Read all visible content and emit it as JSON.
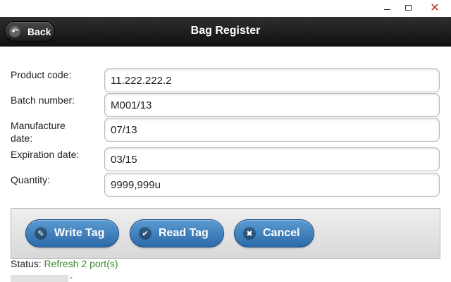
{
  "header": {
    "title": "Bag Register",
    "back_label": "Back"
  },
  "window_controls": {
    "minimize": "minimize",
    "maximize": "maximize",
    "close": "✕"
  },
  "form": {
    "fields": [
      {
        "label": "Product code:",
        "value": "11.222.222.2"
      },
      {
        "label": "Batch number:",
        "value": "M001/13"
      },
      {
        "label": "Manufacture date:",
        "value": "07/13"
      },
      {
        "label": "Expiration date:",
        "value": "03/15"
      },
      {
        "label": "Quantity:",
        "value": "9999,999u"
      }
    ]
  },
  "actions": {
    "write_tag": "Write Tag",
    "read_tag": "Read Tag",
    "cancel": "Cancel"
  },
  "icons": {
    "back": "back-arrow-icon",
    "write": "pencil-icon",
    "read": "checkmark-icon",
    "cancel": "x-icon"
  },
  "status": {
    "label": "Status:",
    "value": "Refresh 2 port(s)"
  },
  "footer": {
    "dash": "-"
  },
  "colors": {
    "header_bg": "#1a1a1a",
    "button_blue": "#3a7bbf",
    "status_green": "#3a8a2a",
    "close_red": "#b03030"
  }
}
